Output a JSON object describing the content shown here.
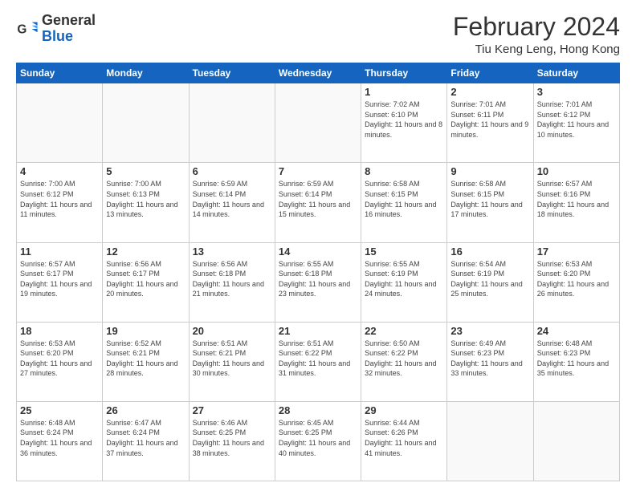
{
  "header": {
    "logo_general": "General",
    "logo_blue": "Blue",
    "month_year": "February 2024",
    "location": "Tiu Keng Leng, Hong Kong"
  },
  "weekdays": [
    "Sunday",
    "Monday",
    "Tuesday",
    "Wednesday",
    "Thursday",
    "Friday",
    "Saturday"
  ],
  "weeks": [
    [
      {
        "day": "",
        "info": ""
      },
      {
        "day": "",
        "info": ""
      },
      {
        "day": "",
        "info": ""
      },
      {
        "day": "",
        "info": ""
      },
      {
        "day": "1",
        "info": "Sunrise: 7:02 AM\nSunset: 6:10 PM\nDaylight: 11 hours and 8 minutes."
      },
      {
        "day": "2",
        "info": "Sunrise: 7:01 AM\nSunset: 6:11 PM\nDaylight: 11 hours and 9 minutes."
      },
      {
        "day": "3",
        "info": "Sunrise: 7:01 AM\nSunset: 6:12 PM\nDaylight: 11 hours and 10 minutes."
      }
    ],
    [
      {
        "day": "4",
        "info": "Sunrise: 7:00 AM\nSunset: 6:12 PM\nDaylight: 11 hours and 11 minutes."
      },
      {
        "day": "5",
        "info": "Sunrise: 7:00 AM\nSunset: 6:13 PM\nDaylight: 11 hours and 13 minutes."
      },
      {
        "day": "6",
        "info": "Sunrise: 6:59 AM\nSunset: 6:14 PM\nDaylight: 11 hours and 14 minutes."
      },
      {
        "day": "7",
        "info": "Sunrise: 6:59 AM\nSunset: 6:14 PM\nDaylight: 11 hours and 15 minutes."
      },
      {
        "day": "8",
        "info": "Sunrise: 6:58 AM\nSunset: 6:15 PM\nDaylight: 11 hours and 16 minutes."
      },
      {
        "day": "9",
        "info": "Sunrise: 6:58 AM\nSunset: 6:15 PM\nDaylight: 11 hours and 17 minutes."
      },
      {
        "day": "10",
        "info": "Sunrise: 6:57 AM\nSunset: 6:16 PM\nDaylight: 11 hours and 18 minutes."
      }
    ],
    [
      {
        "day": "11",
        "info": "Sunrise: 6:57 AM\nSunset: 6:17 PM\nDaylight: 11 hours and 19 minutes."
      },
      {
        "day": "12",
        "info": "Sunrise: 6:56 AM\nSunset: 6:17 PM\nDaylight: 11 hours and 20 minutes."
      },
      {
        "day": "13",
        "info": "Sunrise: 6:56 AM\nSunset: 6:18 PM\nDaylight: 11 hours and 21 minutes."
      },
      {
        "day": "14",
        "info": "Sunrise: 6:55 AM\nSunset: 6:18 PM\nDaylight: 11 hours and 23 minutes."
      },
      {
        "day": "15",
        "info": "Sunrise: 6:55 AM\nSunset: 6:19 PM\nDaylight: 11 hours and 24 minutes."
      },
      {
        "day": "16",
        "info": "Sunrise: 6:54 AM\nSunset: 6:19 PM\nDaylight: 11 hours and 25 minutes."
      },
      {
        "day": "17",
        "info": "Sunrise: 6:53 AM\nSunset: 6:20 PM\nDaylight: 11 hours and 26 minutes."
      }
    ],
    [
      {
        "day": "18",
        "info": "Sunrise: 6:53 AM\nSunset: 6:20 PM\nDaylight: 11 hours and 27 minutes."
      },
      {
        "day": "19",
        "info": "Sunrise: 6:52 AM\nSunset: 6:21 PM\nDaylight: 11 hours and 28 minutes."
      },
      {
        "day": "20",
        "info": "Sunrise: 6:51 AM\nSunset: 6:21 PM\nDaylight: 11 hours and 30 minutes."
      },
      {
        "day": "21",
        "info": "Sunrise: 6:51 AM\nSunset: 6:22 PM\nDaylight: 11 hours and 31 minutes."
      },
      {
        "day": "22",
        "info": "Sunrise: 6:50 AM\nSunset: 6:22 PM\nDaylight: 11 hours and 32 minutes."
      },
      {
        "day": "23",
        "info": "Sunrise: 6:49 AM\nSunset: 6:23 PM\nDaylight: 11 hours and 33 minutes."
      },
      {
        "day": "24",
        "info": "Sunrise: 6:48 AM\nSunset: 6:23 PM\nDaylight: 11 hours and 35 minutes."
      }
    ],
    [
      {
        "day": "25",
        "info": "Sunrise: 6:48 AM\nSunset: 6:24 PM\nDaylight: 11 hours and 36 minutes."
      },
      {
        "day": "26",
        "info": "Sunrise: 6:47 AM\nSunset: 6:24 PM\nDaylight: 11 hours and 37 minutes."
      },
      {
        "day": "27",
        "info": "Sunrise: 6:46 AM\nSunset: 6:25 PM\nDaylight: 11 hours and 38 minutes."
      },
      {
        "day": "28",
        "info": "Sunrise: 6:45 AM\nSunset: 6:25 PM\nDaylight: 11 hours and 40 minutes."
      },
      {
        "day": "29",
        "info": "Sunrise: 6:44 AM\nSunset: 6:26 PM\nDaylight: 11 hours and 41 minutes."
      },
      {
        "day": "",
        "info": ""
      },
      {
        "day": "",
        "info": ""
      }
    ]
  ]
}
